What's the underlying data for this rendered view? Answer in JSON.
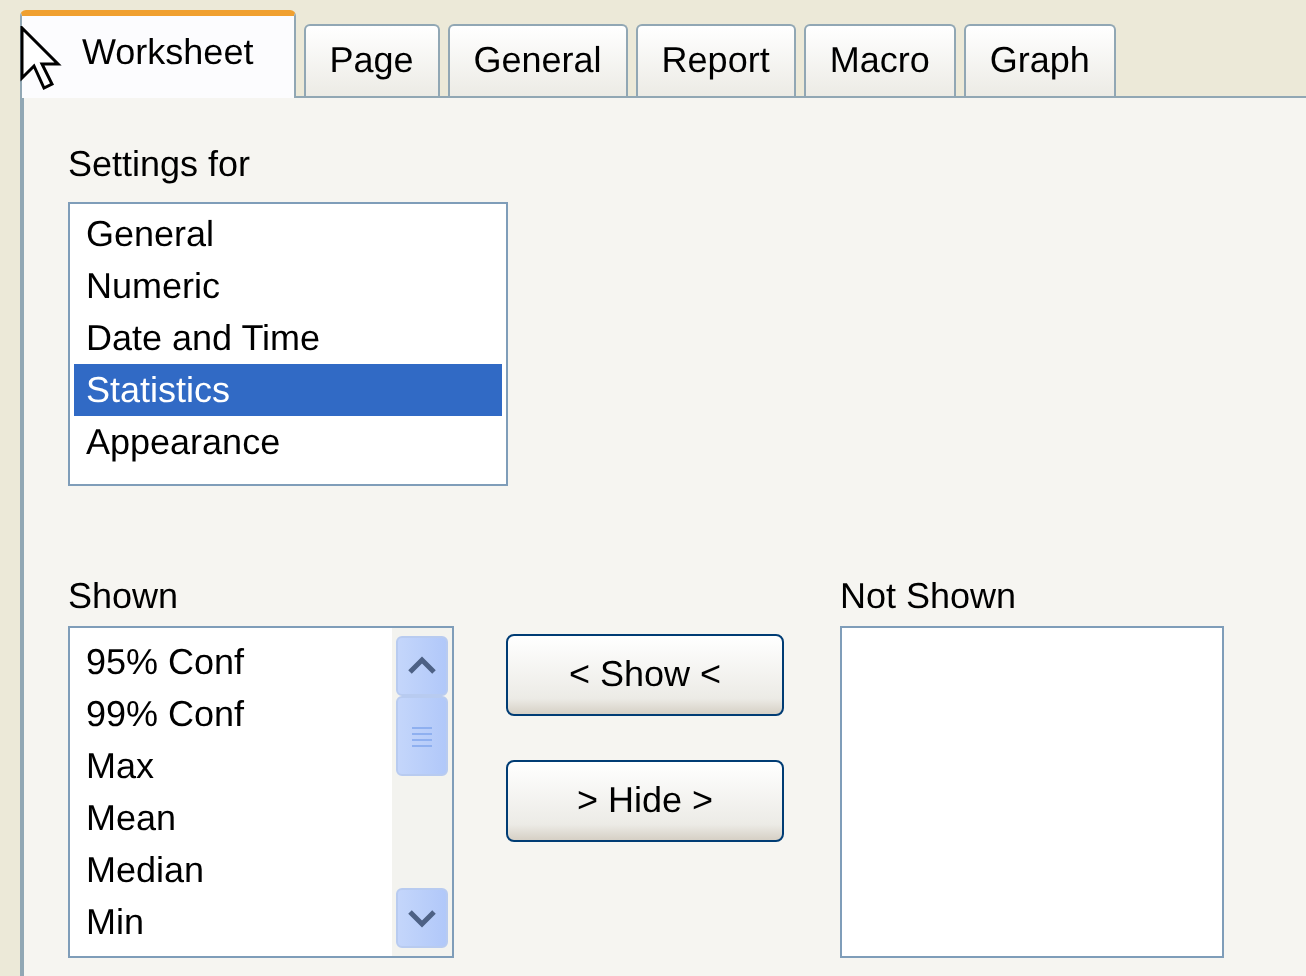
{
  "tabs": [
    {
      "label": "Worksheet",
      "selected": true
    },
    {
      "label": "Page",
      "selected": false
    },
    {
      "label": "General",
      "selected": false
    },
    {
      "label": "Report",
      "selected": false
    },
    {
      "label": "Macro",
      "selected": false
    },
    {
      "label": "Graph",
      "selected": false
    }
  ],
  "settings_for": {
    "label": "Settings for",
    "items": [
      {
        "label": "General",
        "selected": false
      },
      {
        "label": "Numeric",
        "selected": false
      },
      {
        "label": "Date and Time",
        "selected": false
      },
      {
        "label": "Statistics",
        "selected": true
      },
      {
        "label": "Appearance",
        "selected": false
      }
    ]
  },
  "shown": {
    "label": "Shown",
    "items": [
      "95% Conf",
      "99% Conf",
      "Max",
      "Mean",
      "Median",
      "Min"
    ]
  },
  "buttons": [
    "< Show <",
    "> Hide >"
  ],
  "not_shown": {
    "label": "Not Shown"
  }
}
